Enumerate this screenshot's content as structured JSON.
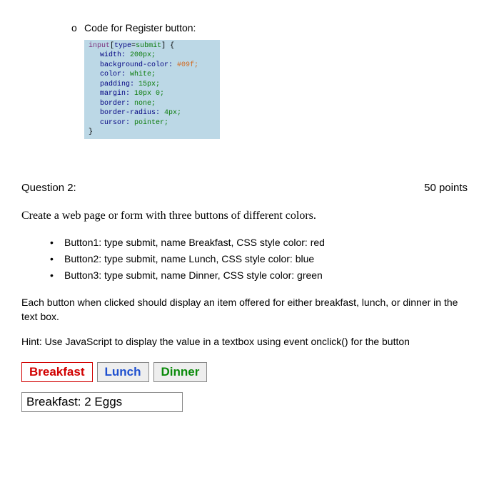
{
  "code_section": {
    "marker": "o",
    "title": "Code for Register button:",
    "lines": [
      [
        {
          "t": "input",
          "c": "tok-selector"
        },
        {
          "t": "[",
          "c": "tok-brace"
        },
        {
          "t": "type",
          "c": "tok-prop"
        },
        {
          "t": "=",
          "c": "tok-brace"
        },
        {
          "t": "submit",
          "c": "tok-val"
        },
        {
          "t": "] {",
          "c": "tok-brace"
        }
      ],
      [
        {
          "t": "width:",
          "c": "tok-prop"
        },
        {
          "t": " 200px;",
          "c": "tok-val"
        }
      ],
      [
        {
          "t": "background-color:",
          "c": "tok-prop"
        },
        {
          "t": " #09f;",
          "c": "tok-hex"
        }
      ],
      [
        {
          "t": "color:",
          "c": "tok-prop"
        },
        {
          "t": " white;",
          "c": "tok-val"
        }
      ],
      [
        {
          "t": "padding:",
          "c": "tok-prop"
        },
        {
          "t": " 15px;",
          "c": "tok-val"
        }
      ],
      [
        {
          "t": "margin:",
          "c": "tok-prop"
        },
        {
          "t": " 10px 0;",
          "c": "tok-val"
        }
      ],
      [
        {
          "t": "border:",
          "c": "tok-prop"
        },
        {
          "t": " none;",
          "c": "tok-val"
        }
      ],
      [
        {
          "t": "border-radius:",
          "c": "tok-prop"
        },
        {
          "t": " 4px;",
          "c": "tok-val"
        }
      ],
      [
        {
          "t": "cursor:",
          "c": "tok-prop"
        },
        {
          "t": " pointer;",
          "c": "tok-val"
        }
      ],
      [
        {
          "t": "}",
          "c": "tok-brace"
        }
      ]
    ]
  },
  "q2": {
    "label": "Question 2:",
    "points": "50 points",
    "intro": "Create a web page or form with three buttons of different colors.",
    "bullets": [
      "Button1: type submit, name Breakfast, CSS style color: red",
      "Button2: type submit, name Lunch, CSS style color: blue",
      "Button3: type submit, name Dinner, CSS style color: green"
    ],
    "desc": "Each button when clicked should display an item offered for either breakfast, lunch, or dinner in the text box.",
    "hint": "Hint: Use JavaScript to display the value in a textbox using event onclick() for the button",
    "buttons": {
      "breakfast": "Breakfast",
      "lunch": "Lunch",
      "dinner": "Dinner"
    },
    "output": "Breakfast: 2 Eggs"
  }
}
